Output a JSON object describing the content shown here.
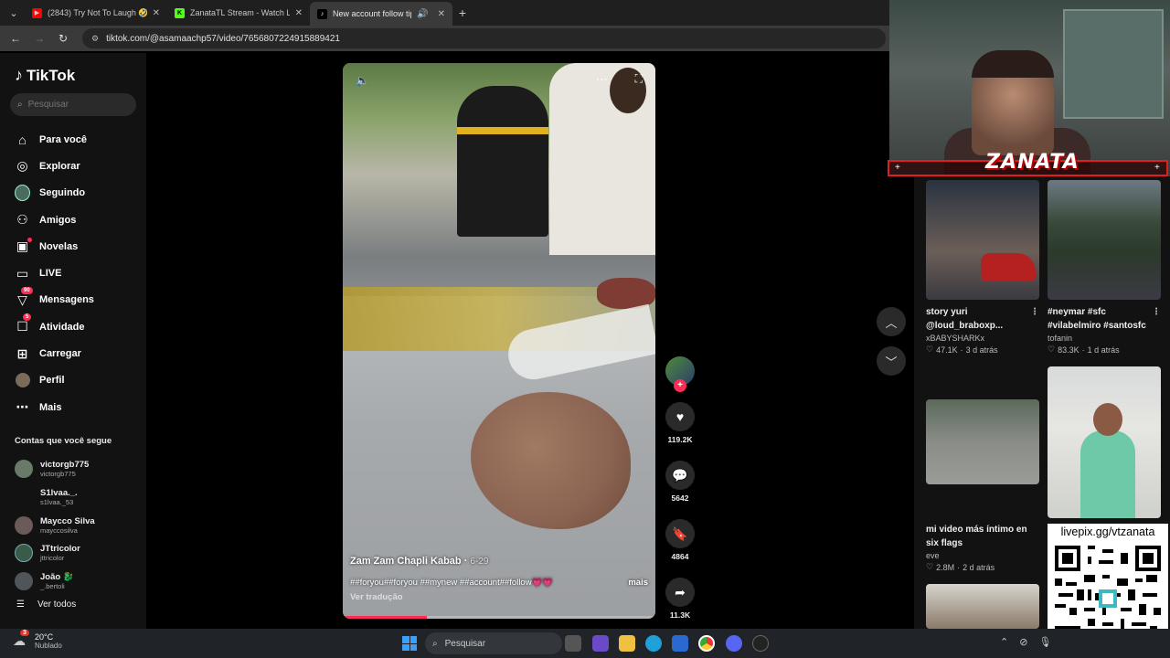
{
  "browser": {
    "tabs": [
      {
        "title": "(2843) Try Not To Laugh 🤣 Top",
        "icon": "youtube-icon",
        "color": "#ff0000",
        "active": false
      },
      {
        "title": "ZanataTL Stream - Watch Live o",
        "icon": "kick-icon",
        "color": "#53fc18",
        "active": false
      },
      {
        "title": "New account follow tips: hc",
        "icon": "tiktok-icon",
        "color": "#000000",
        "active": true
      }
    ],
    "url": "tiktok.com/@asamaachp57/video/7656807224915889421"
  },
  "sidebar": {
    "logo": "TikTok",
    "search_placeholder": "Pesquisar",
    "nav": [
      {
        "label": "Para você",
        "icon": "home-icon",
        "glyph": "⌂"
      },
      {
        "label": "Explorar",
        "icon": "compass-icon",
        "glyph": "◎"
      },
      {
        "label": "Seguindo",
        "icon": "following-avatar-icon",
        "glyph": "●"
      },
      {
        "label": "Amigos",
        "icon": "friends-icon",
        "glyph": "⚇"
      },
      {
        "label": "Novelas",
        "icon": "series-icon",
        "glyph": "▣",
        "dot": true
      },
      {
        "label": "LIVE",
        "icon": "live-tv-icon",
        "glyph": "▭"
      },
      {
        "label": "Mensagens",
        "icon": "messages-icon",
        "glyph": "▽",
        "badge": "90"
      },
      {
        "label": "Atividade",
        "icon": "activity-icon",
        "glyph": "☐",
        "badge": "5"
      },
      {
        "label": "Carregar",
        "icon": "upload-icon",
        "glyph": "⊞"
      },
      {
        "label": "Perfil",
        "icon": "profile-avatar-icon",
        "glyph": "●"
      },
      {
        "label": "Mais",
        "icon": "more-icon",
        "glyph": "⋯"
      }
    ],
    "following_header": "Contas que você segue",
    "following": [
      {
        "name": "victorgb775",
        "handle": "victorgb775",
        "color": "#6a7a68"
      },
      {
        "name": "S1lvaa._.",
        "handle": "s1lvaa._53",
        "color": "#121212"
      },
      {
        "name": "Maycco Silva",
        "handle": "mayccosilva",
        "color": "#6b5b58"
      },
      {
        "name": "JTtricolor",
        "handle": "jttricolor",
        "color": "#3a5a4a"
      },
      {
        "name": "João 🐉",
        "handle": "_.bertoli",
        "color": "#50555a"
      }
    ],
    "see_all": "Ver todos"
  },
  "video": {
    "title": "Zam Zam Chapli Kabab",
    "date": "6-29",
    "tags": "##foryou##foryou ##mynew ##account##follow💗💗",
    "more": "mais",
    "translate": "Ver tradução",
    "progress": 0.27
  },
  "actions": {
    "likes": "119.2K",
    "comments": "5642",
    "saves": "4864",
    "shares": "11.3K"
  },
  "overlay": {
    "streamer_logo": "ZANATA",
    "livepix": "livepix.gg/vtzanata"
  },
  "feed": [
    {
      "title": "story yuri @loud_braboxp...",
      "author": "xBABYSHARKx",
      "likes": "47.1K",
      "age": "3 d atrás"
    },
    {
      "title": "#neymar #sfc #vilabelmiro #santosfc",
      "author": "tofanin",
      "likes": "83.3K",
      "age": "1 d atrás"
    },
    {
      "title": "mi video más íntimo en six flags",
      "author": "eve",
      "likes": "2.8M",
      "age": "2 d atrás"
    }
  ],
  "taskbar": {
    "temp": "20°C",
    "condition": "Nublado",
    "weather_badge": "3",
    "search_placeholder": "Pesquisar"
  }
}
